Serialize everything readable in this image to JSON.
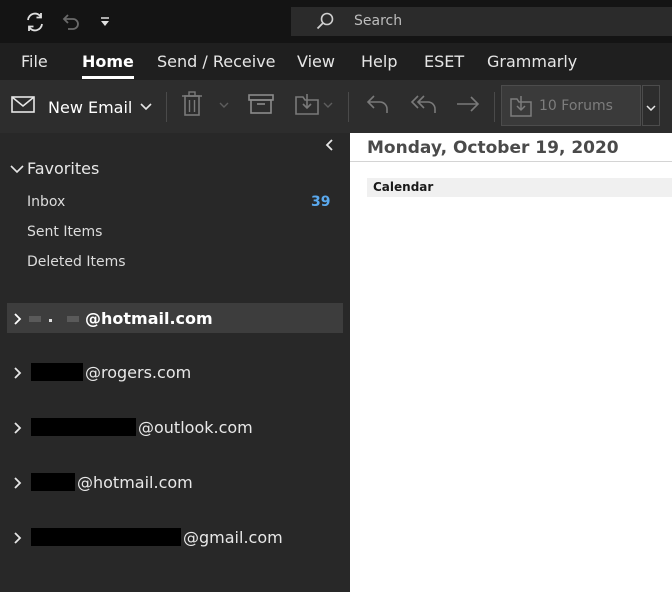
{
  "search": {
    "placeholder": "Search"
  },
  "menu": {
    "tabs": [
      "File",
      "Home",
      "Send / Receive",
      "View",
      "Help",
      "ESET",
      "Grammarly"
    ],
    "active": "Home"
  },
  "ribbon": {
    "new_email_label": "New Email",
    "quick_step_label": "10 Forums"
  },
  "sidebar": {
    "favorites_label": "Favorites",
    "folders": [
      {
        "label": "Inbox",
        "count": "39"
      },
      {
        "label": "Sent Items"
      },
      {
        "label": "Deleted Items"
      }
    ],
    "accounts": [
      {
        "label": "@hotmail.com",
        "selected": true
      },
      {
        "label": "@rogers.com"
      },
      {
        "label": "@outlook.com"
      },
      {
        "label": "@hotmail.com"
      },
      {
        "label": "@gmail.com"
      }
    ]
  },
  "calendar": {
    "date": "Monday, October 19, 2020",
    "section_label": "Calendar"
  },
  "colors": {
    "accent_count": "#5aa9ee",
    "titlebar": "#141414",
    "ribbon": "#2d2d2d",
    "folder_pane": "#282828"
  },
  "icons": [
    "refresh-icon",
    "undo-icon",
    "customize-toolbar-icon",
    "search-icon",
    "mail-icon",
    "trash-icon",
    "archive-icon",
    "move-icon",
    "reply-icon",
    "reply-all-icon",
    "forward-icon",
    "chevron-right-icon",
    "chevron-down-icon",
    "chevron-left-icon"
  ]
}
